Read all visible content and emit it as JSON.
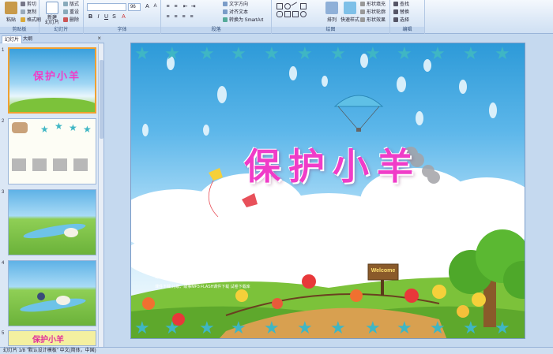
{
  "ribbon": {
    "paste_label": "粘贴",
    "clipboard_items": [
      "剪切",
      "复制",
      "格式刷"
    ],
    "clipboard_group": "剪贴板",
    "new_slide_label": "新建\n幻灯片",
    "slides_items": [
      "版式",
      "重设",
      "删除"
    ],
    "slides_group": "幻灯片",
    "font_size_value": "96",
    "font_group": "字体",
    "paragraph_items": [
      "文字方向",
      "对齐文本",
      "转换为 SmartArt"
    ],
    "paragraph_group": "段落",
    "arrange_label": "排列",
    "quick_styles_label": "快速样式",
    "shape_fill_items": [
      "形状填充",
      "形状轮廓",
      "形状效果"
    ],
    "drawing_group": "绘图",
    "editing_items": [
      "查找",
      "替换",
      "选择"
    ],
    "editing_group": "编辑"
  },
  "panel": {
    "tab_slides": "幻灯片",
    "tab_outline": "大纲",
    "slide_numbers": [
      "1",
      "2",
      "3",
      "4",
      "5"
    ],
    "thumb5_title": "保护小羊"
  },
  "slide": {
    "title": "保护小羊",
    "watermark_cn": "幼教资源网站",
    "watermark_url": "ziyuan.baby611.com",
    "watermark_sub": "课件下载 儿歌、故事MP3 FLASH课件下载 试卷下载库",
    "welcome_sign": "Welcome"
  },
  "status": {
    "text": "幻灯片 1/8    \"默认设计模板\"    中文(简体，中国)"
  },
  "colors": {
    "title": "#f03cc8",
    "ribbon_bg": "#dde9f7",
    "panel_bg": "#dbe7f5",
    "sky_top": "#2d9ad8",
    "grass": "#7cc23a",
    "star": "#3fb6c4"
  }
}
